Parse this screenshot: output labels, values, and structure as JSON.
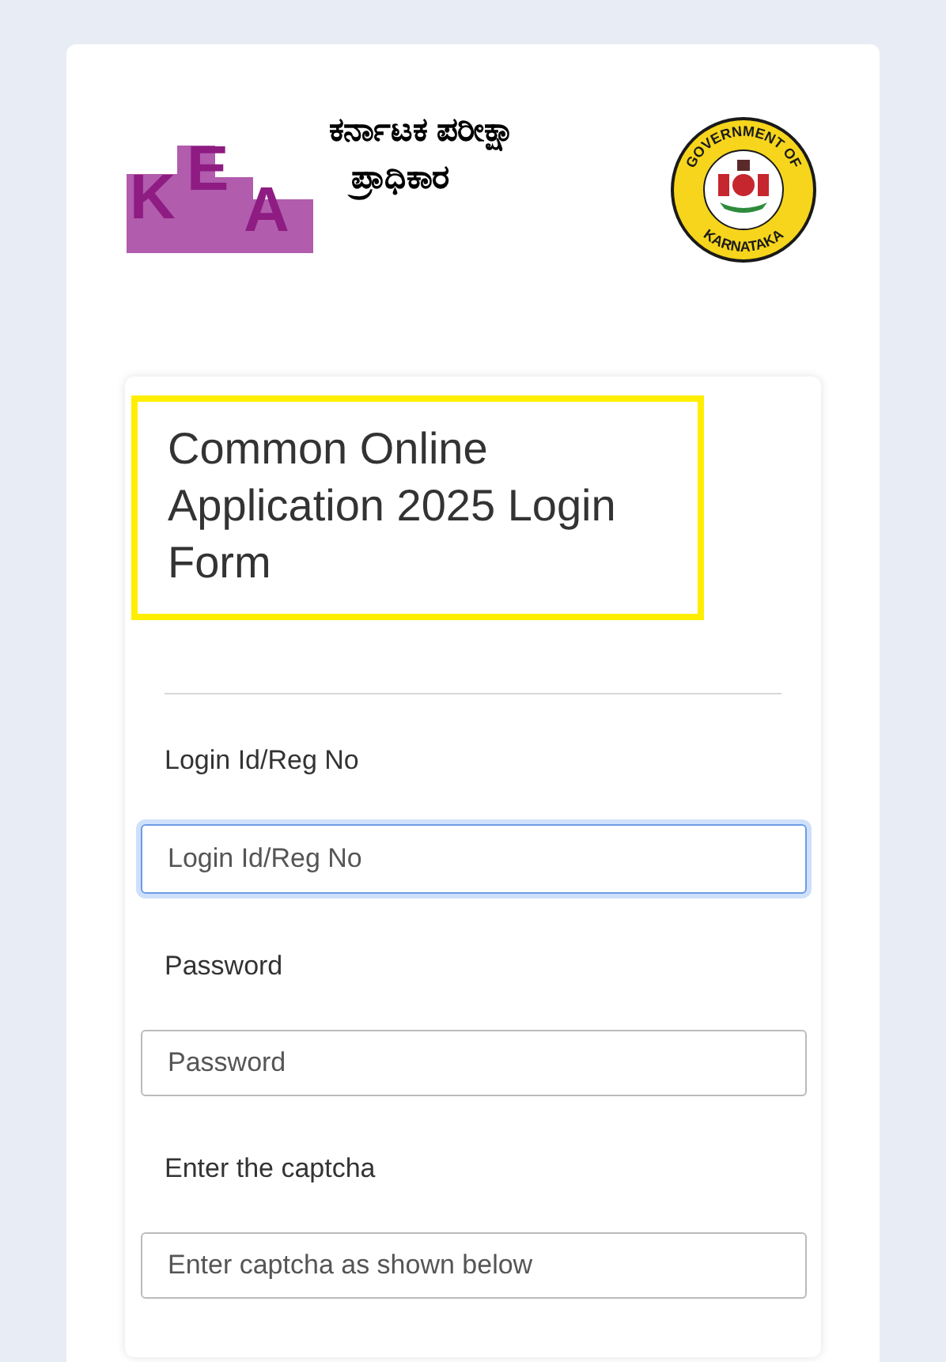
{
  "header": {
    "logo_letters": [
      "K",
      "E",
      "A"
    ],
    "authority_name": [
      "ಕರ್ನಾಟಕ ಪರೀಕ್ಷಾ",
      "ಪ್ರಾಧಿಕಾರ"
    ],
    "emblem": {
      "top_text": "GOVERNMENT OF",
      "bottom_text": "KARNATAKA"
    }
  },
  "form": {
    "title": "Common Online Application 2025 Login Form",
    "title_highlighted": true,
    "fields": [
      {
        "label": "Login Id/Reg No",
        "placeholder": "Login Id/Reg No",
        "focused": true
      },
      {
        "label": "Password",
        "placeholder": "Password",
        "focused": false
      },
      {
        "label": "Enter the captcha",
        "placeholder": "Enter captcha as shown below",
        "focused": false
      }
    ]
  }
}
